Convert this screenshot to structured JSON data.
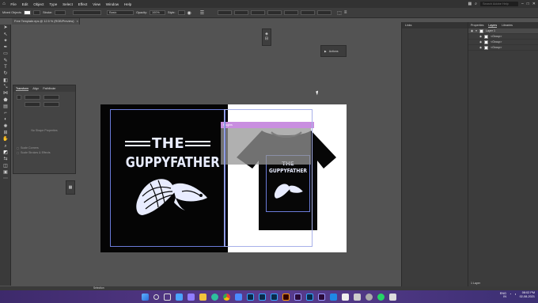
{
  "menubar": {
    "items": [
      "File",
      "Edit",
      "Object",
      "Type",
      "Select",
      "Effect",
      "View",
      "Window",
      "Help"
    ],
    "search_placeholder": "Search Adobe Help"
  },
  "control_bar": {
    "object_label": "Mixed Objects",
    "stroke_label": "Stroke:",
    "brush_label": "Basic",
    "opacity_label": "Opacity:",
    "opacity_value": "100%",
    "style_label": "Style:"
  },
  "document_tab": {
    "title": "Free Template.eps @ 12.5 % (RGB/Preview)",
    "close": "×"
  },
  "transform_panel": {
    "tabs": [
      "Transform",
      "Align",
      "Pathfinder"
    ],
    "empty_text": "No Shape Properties",
    "check1": "Scale Corners",
    "check2": "Scale Strokes & Effects"
  },
  "actions_panel": {
    "label": "Actions"
  },
  "links_panel": {
    "title": "Links"
  },
  "layers_panel": {
    "tabs": [
      "Properties",
      "Layers",
      "Libraries"
    ],
    "layers": [
      {
        "name": "Layer 1"
      },
      {
        "name": "<Group>"
      },
      {
        "name": "<Group>"
      },
      {
        "name": "<Group>"
      }
    ],
    "footer": "1 Layer"
  },
  "artwork": {
    "line1": "THE",
    "line2": "GUPPYFATHER",
    "mock_title": "THE",
    "mock_sub": "GUPPYFATHER"
  },
  "overlay": {
    "label": "Plugins"
  },
  "status": {
    "selection_label": "Selection"
  },
  "tray": {
    "lang": "ENG",
    "region": "IN",
    "time": "08:02 PM",
    "date": "02-08-2021"
  },
  "colors": {
    "accent_selection": "#6a7bd9",
    "overlay_bar": "#c98ee0",
    "taskbar_gradient_start": "#3d2a6b",
    "taskbar_gradient_end": "#3b2f72"
  }
}
